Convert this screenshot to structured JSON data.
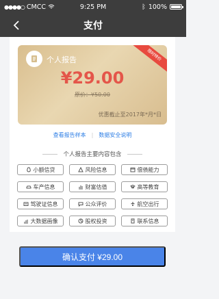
{
  "status": {
    "carrier": "CMCC",
    "time": "9:25 PM",
    "battery": "100%"
  },
  "nav": {
    "title": "支付"
  },
  "card": {
    "label": "个人报告",
    "badge": "限时特价",
    "price": "¥29.00",
    "original_price": "原价：¥50.00",
    "deadline": "优惠截止至2017年*月*日"
  },
  "links": {
    "sample": "查看报告样本",
    "security": "数据安全说明"
  },
  "section": {
    "title": "个人报告主要内容包含"
  },
  "items": [
    {
      "label": "小额信贷",
      "icon": "money-bag-icon"
    },
    {
      "label": "风险信息",
      "icon": "warning-icon"
    },
    {
      "label": "偿债能力",
      "icon": "calendar-icon"
    },
    {
      "label": "车产信息",
      "icon": "car-icon"
    },
    {
      "label": "财富估值",
      "icon": "chart-icon"
    },
    {
      "label": "高等教育",
      "icon": "graduation-icon"
    },
    {
      "label": "驾驶证信息",
      "icon": "id-card-icon"
    },
    {
      "label": "公众评价",
      "icon": "comment-icon"
    },
    {
      "label": "航空出行",
      "icon": "plane-icon"
    },
    {
      "label": "大数据画像",
      "icon": "bar-chart-icon"
    },
    {
      "label": "股权投资",
      "icon": "pie-chart-icon"
    },
    {
      "label": "联系信息",
      "icon": "contact-icon"
    }
  ],
  "pay": {
    "label": "确认支付 ¥29.00"
  }
}
